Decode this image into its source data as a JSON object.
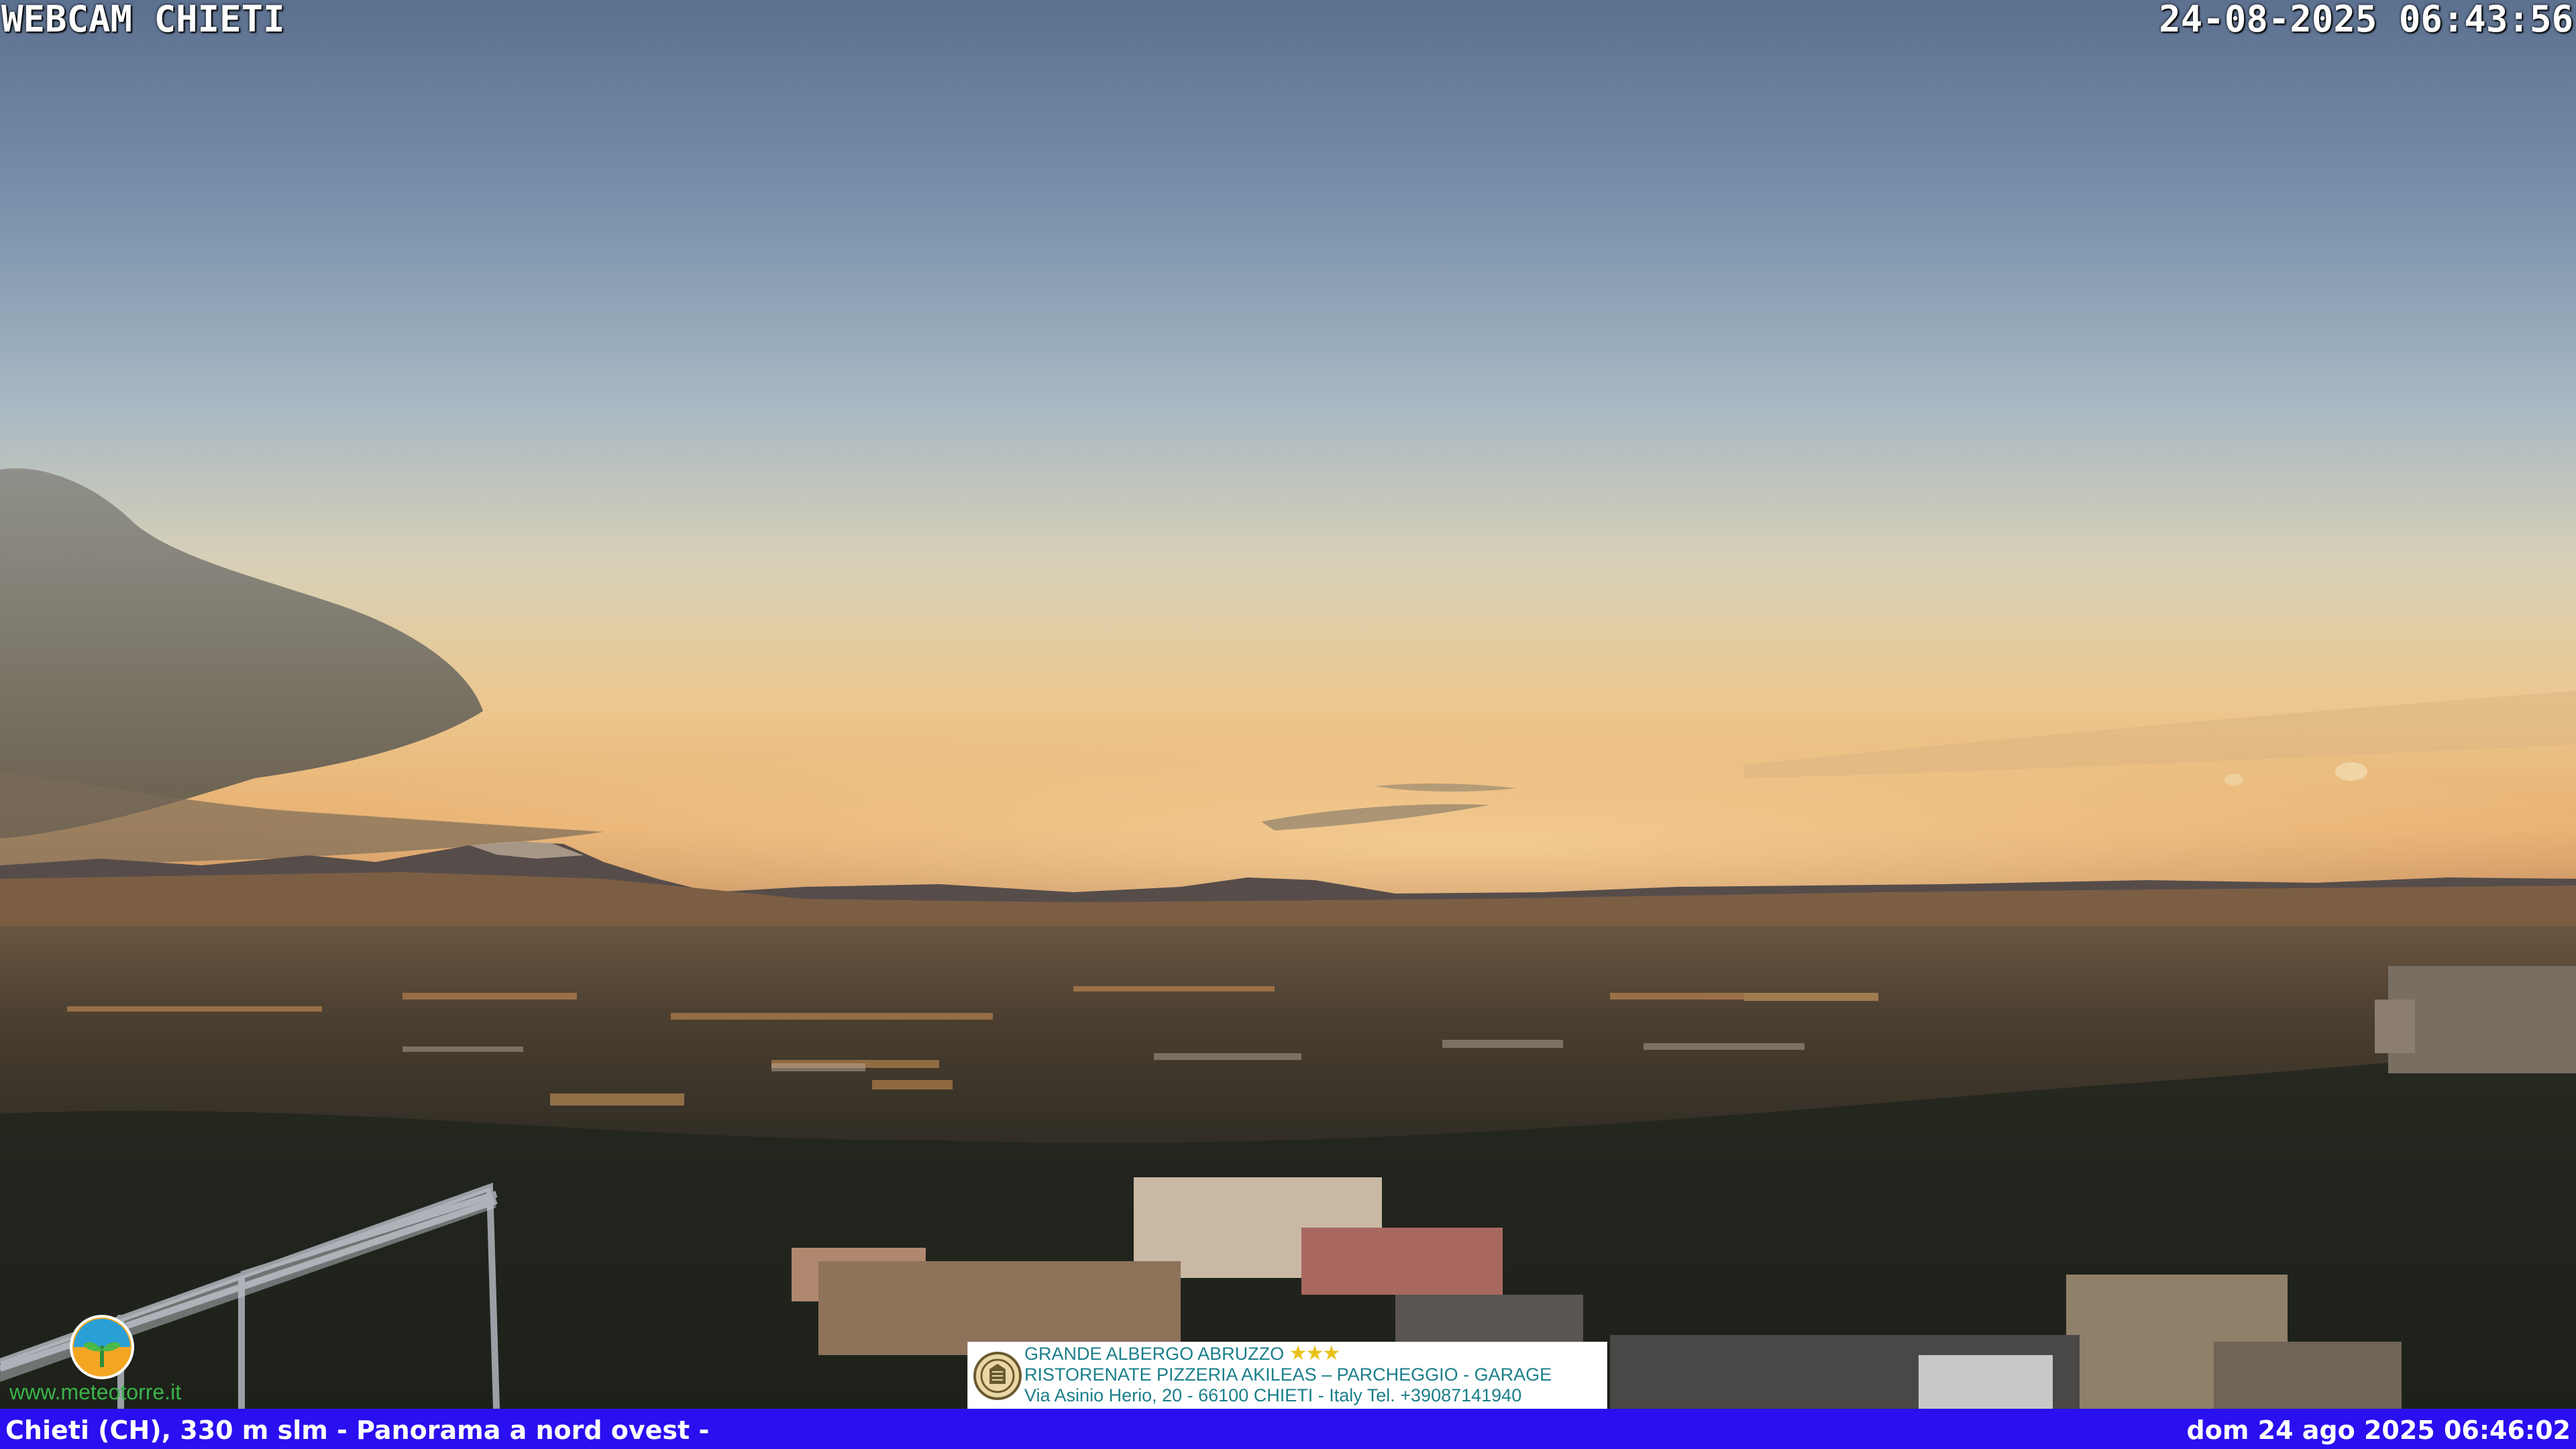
{
  "webcam": {
    "title": "WEBCAM CHIETI",
    "timestamp": "24-08-2025 06:43:56"
  },
  "footer": {
    "location": "Chieti (CH), 330 m slm - Panorama a nord ovest -",
    "datetime": "dom 24 ago 2025 06:46:02"
  },
  "advertisement": {
    "line1": "GRANDE ALBERGO ABRUZZO",
    "stars": "★★★",
    "line2": "RISTORENATE PIZZERIA AKILEAS – PARCHEGGIO - GARAGE",
    "line3": "Via Asinio Herio, 20 - 66100 CHIETI - Italy Tel. +39087141940"
  },
  "branding": {
    "url": "www.meteotorre.it",
    "icon": "meteotorre-logo-icon"
  },
  "colors": {
    "footer_bar": "#2a0ff0",
    "ad_text": "#1a7f8a",
    "sky_top": "#5f7593",
    "horizon": "#f0c480"
  }
}
